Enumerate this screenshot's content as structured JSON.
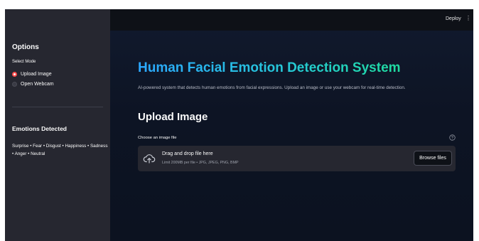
{
  "header": {
    "deploy_label": "Deploy",
    "menu_glyph": "⋮"
  },
  "sidebar": {
    "title": "Options",
    "mode_label": "Select Mode",
    "modes": [
      {
        "label": "Upload Image",
        "selected": true
      },
      {
        "label": "Open Webcam",
        "selected": false
      }
    ],
    "emotions_title": "Emotions Detected",
    "emotions_text": "Surprise • Fear • Disgust • Happiness • Sadness • Anger • Neutral"
  },
  "main": {
    "title": "Human Facial Emotion Detection System",
    "subtitle": "AI-powered system that detects human emotions from facial expressions. Upload an image or use your webcam for real-time detection.",
    "section_title": "Upload Image",
    "uploader": {
      "label": "Choose an image file",
      "drop_text": "Drag and drop file here",
      "limit_text": "Limit 200MB per file • JPG, JPEG, PNG, BMP",
      "browse_label": "Browse files",
      "icons": {
        "upload": "cloud-upload-icon",
        "help": "help-circle-icon"
      }
    }
  },
  "colors": {
    "background": "#0e1117",
    "sidebar": "#262730",
    "radio_selected": "#ff4b4b",
    "title_gradient_start": "#2ba8ff",
    "title_gradient_end": "#1fdc9f"
  }
}
